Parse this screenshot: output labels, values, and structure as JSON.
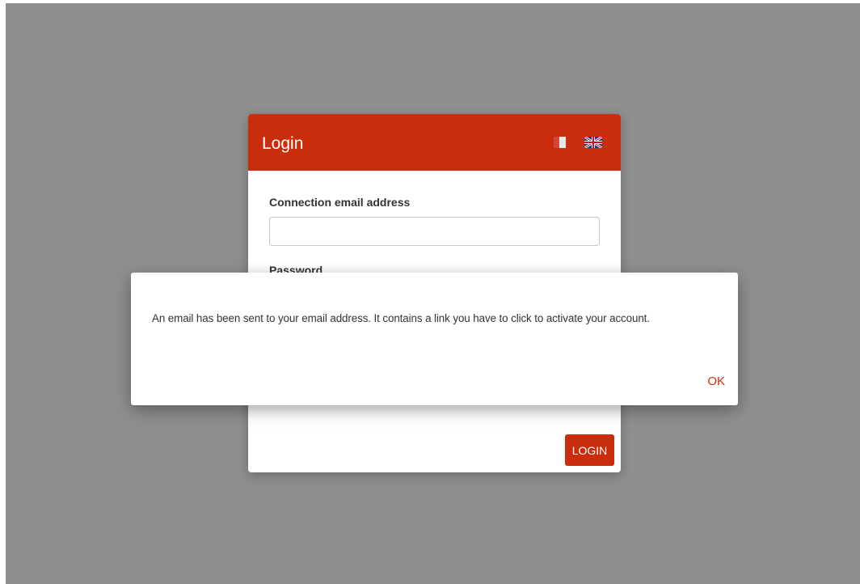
{
  "login": {
    "title": "Login",
    "email_label": "Connection email address",
    "email_value": "",
    "password_label": "Password",
    "login_button": "LOGIN"
  },
  "dialog": {
    "message": "An email has been sent to your email address. It contains a link you have to click to activate your account.",
    "ok_label": "OK"
  },
  "colors": {
    "accent": "#c92d0b",
    "backdrop": "#8f8f8f"
  },
  "icons": {
    "lang_fr": "france-flag-icon",
    "lang_en": "uk-flag-icon"
  }
}
